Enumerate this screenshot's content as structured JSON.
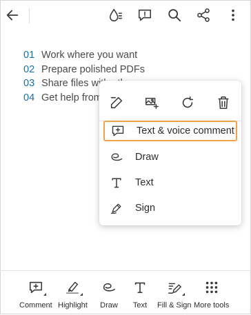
{
  "topbar": {
    "icons": [
      "back-arrow-icon",
      "read-aloud-icon",
      "comments-icon",
      "search-icon",
      "share-icon",
      "more-vertical-icon"
    ]
  },
  "document": {
    "items": [
      {
        "num": "01",
        "text": "Work where you want"
      },
      {
        "num": "02",
        "text": "Prepare polished PDFs"
      },
      {
        "num": "03",
        "text": "Share files with others"
      },
      {
        "num": "04",
        "text": "Get help from"
      }
    ]
  },
  "popup": {
    "actions": [
      "edit-icon",
      "add-image-icon",
      "rotate-icon",
      "delete-icon"
    ],
    "items": [
      {
        "label": "Text & voice comment",
        "icon": "comment-plus-icon",
        "highlighted": true
      },
      {
        "label": "Draw",
        "icon": "draw-icon"
      },
      {
        "label": "Text",
        "icon": "text-icon"
      },
      {
        "label": "Sign",
        "icon": "sign-icon"
      }
    ],
    "highlight_color": "#f0a24a"
  },
  "bottombar": {
    "items": [
      {
        "label": "Comment",
        "icon": "comment-icon"
      },
      {
        "label": "Highlight",
        "icon": "highlight-icon"
      },
      {
        "label": "Draw",
        "icon": "draw-icon"
      },
      {
        "label": "Text",
        "icon": "text-icon"
      },
      {
        "label": "Fill & Sign",
        "icon": "fill-sign-icon"
      },
      {
        "label": "More tools",
        "icon": "more-tools-icon"
      }
    ]
  },
  "colors": {
    "list_number": "#1b6fa6",
    "text": "#2c2c2c",
    "highlight": "#f0a24a"
  }
}
